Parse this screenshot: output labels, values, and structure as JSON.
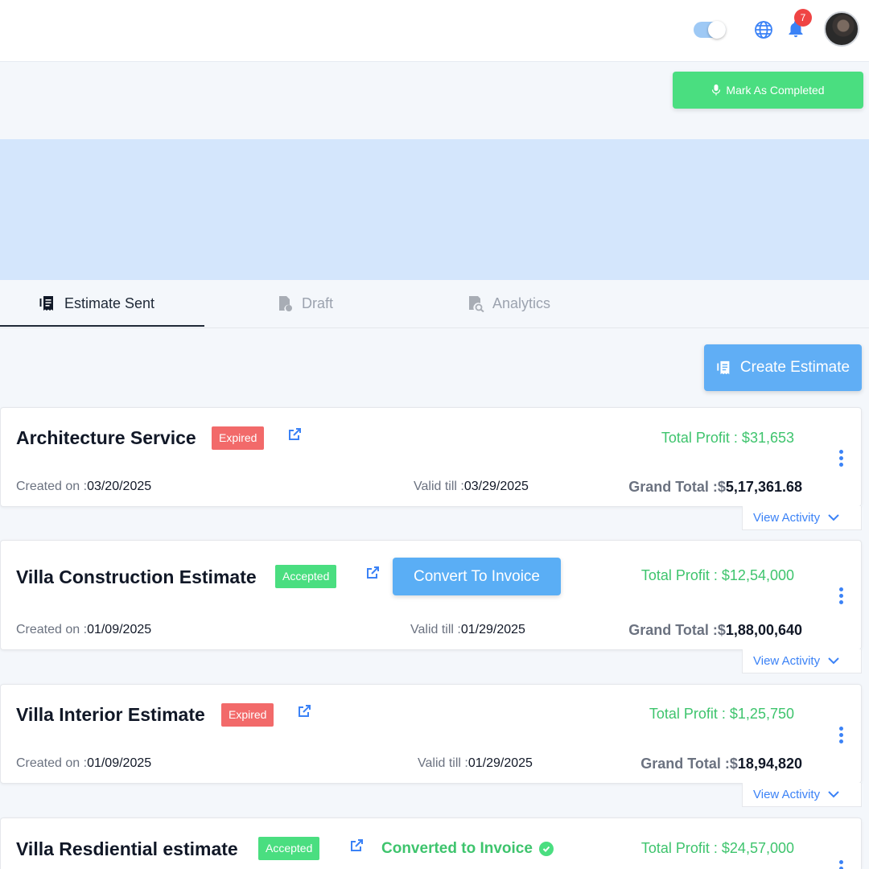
{
  "header": {
    "notification_count": "7"
  },
  "actions": {
    "mark_completed_label": "Mark As Completed",
    "create_estimate_label": "Create Estimate"
  },
  "tabs": [
    {
      "label": "Estimate Sent",
      "active": true
    },
    {
      "label": "Draft",
      "active": false
    },
    {
      "label": "Analytics",
      "active": false
    }
  ],
  "estimates": [
    {
      "title": "Architecture Service",
      "status": "Expired",
      "profit": "Total Profit : $31,653",
      "created_label": "Created on :",
      "created": "03/20/2025",
      "valid_label": "Valid till :",
      "valid": "03/29/2025",
      "grand_label": "Grand Total :$",
      "grand": "5,17,361.68",
      "activity": "View Activity"
    },
    {
      "title": "Villa Construction Estimate",
      "status": "Accepted",
      "action": "Convert To Invoice",
      "profit": "Total Profit : $12,54,000",
      "created_label": "Created on :",
      "created": "01/09/2025",
      "valid_label": "Valid till :",
      "valid": "01/29/2025",
      "grand_label": "Grand Total :$",
      "grand": "1,88,00,640",
      "activity": "View Activity"
    },
    {
      "title": "Villa Interior Estimate",
      "status": "Expired",
      "profit": "Total Profit : $1,25,750",
      "created_label": "Created on :",
      "created": "01/09/2025",
      "valid_label": "Valid till :",
      "valid": "01/29/2025",
      "grand_label": "Grand Total :$",
      "grand": "18,94,820",
      "activity": "View Activity"
    },
    {
      "title": "Villa Resdiential estimate",
      "status": "Accepted",
      "converted": "Converted to Invoice",
      "profit": "Total Profit : $24,57,000"
    }
  ],
  "colors": {
    "primary": "#60aef5",
    "success": "#4ade80",
    "danger": "#f26a6a",
    "banner": "#d4e6fc"
  }
}
